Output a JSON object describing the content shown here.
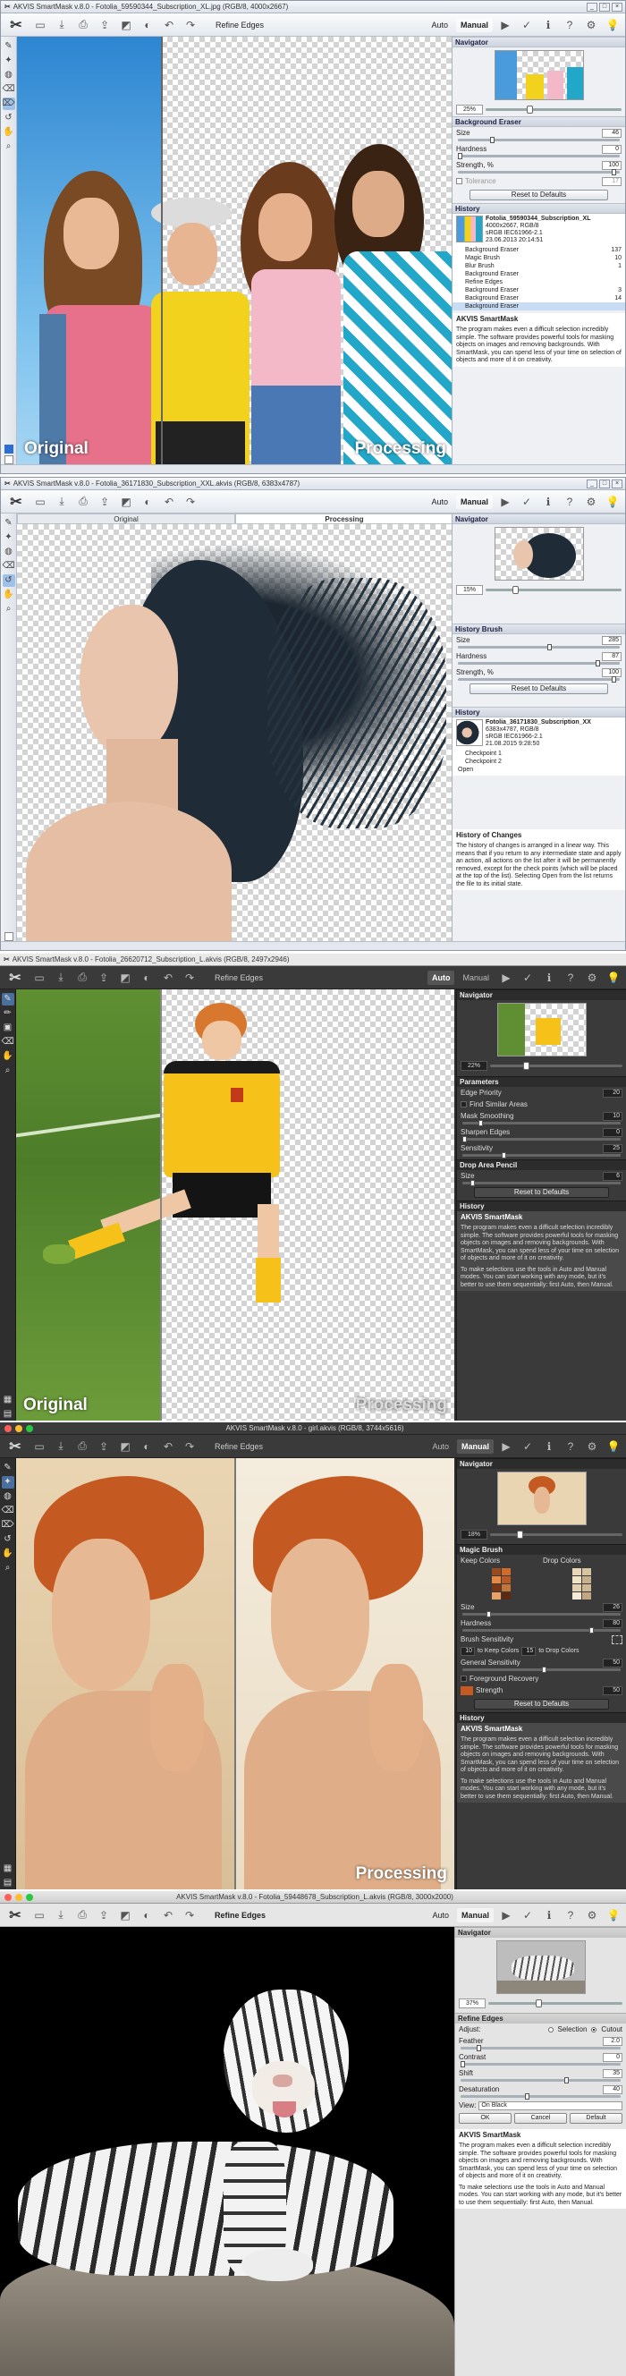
{
  "w1": {
    "title": "AKVIS SmartMask v.8.0 - Fotolia_59590344_Subscription_XL.jpg (RGB/8, 4000x2667)",
    "refine": "Refine Edges",
    "modes": {
      "auto": "Auto",
      "manual": "Manual"
    },
    "labels": {
      "original": "Original",
      "processing": "Processing"
    },
    "navigator": {
      "title": "Navigator",
      "zoom": "25%"
    },
    "bg_eraser": {
      "title": "Background Eraser",
      "params": [
        {
          "label": "Size",
          "value": "46"
        },
        {
          "label": "Hardness",
          "value": "0"
        },
        {
          "label": "Strength, %",
          "value": "100"
        }
      ],
      "tolerance_label": "Tolerance",
      "tolerance_value": "17",
      "reset": "Reset to Defaults"
    },
    "history": {
      "title": "History",
      "file_lines": [
        "Fotolia_59590344_Subscription_XL",
        "4000x2667, RGB/8",
        "sRGB IEC61966-2.1",
        "23.06.2013 20:14:51"
      ],
      "items": [
        {
          "label": "Background Eraser",
          "n": "137"
        },
        {
          "label": "Magic Brush",
          "n": "10"
        },
        {
          "label": "Blur Brush",
          "n": "1"
        },
        {
          "label": "Background Eraser",
          "n": ""
        },
        {
          "label": "Refine Edges",
          "n": ""
        },
        {
          "label": "Background Eraser",
          "n": "3"
        },
        {
          "label": "Background Eraser",
          "n": "14"
        },
        {
          "label": "Background Eraser",
          "n": ""
        }
      ]
    },
    "hint": {
      "title": "AKVIS SmartMask",
      "text": "The program makes even a difficult selection incredibly simple. The software provides powerful tools for masking objects on images and removing backgrounds. With SmartMask, you can spend less of your time on selection of objects and more of it on creativity."
    }
  },
  "w2": {
    "title": "AKVIS SmartMask v.8.0 - Fotolia_36171830_Subscription_XXL.akvis (RGB/8, 6383x4787)",
    "tabs": {
      "original": "Original",
      "processing": "Processing"
    },
    "modes": {
      "auto": "Auto",
      "manual": "Manual"
    },
    "navigator": {
      "title": "Navigator",
      "zoom": "15%"
    },
    "history_brush": {
      "title": "History Brush",
      "params": [
        {
          "label": "Size",
          "value": "285"
        },
        {
          "label": "Hardness",
          "value": "87"
        },
        {
          "label": "Strength, %",
          "value": "100"
        }
      ],
      "reset": "Reset to Defaults"
    },
    "history": {
      "title": "History",
      "file_lines": [
        "Fotolia_36171830_Subscription_XX",
        "6383x4787, RGB/8",
        "sRGB IEC61966-2.1",
        "21.08.2015 9:28:50"
      ],
      "items": [
        {
          "label": "Checkpoint 1",
          "n": ""
        },
        {
          "label": "Checkpoint 2",
          "n": ""
        },
        {
          "label": "Open",
          "n": ""
        }
      ]
    },
    "hint": {
      "title": "History of Changes",
      "text": "The history of changes is arranged in a linear way. This means that if you return to any intermediate state and apply an action, all actions on the list after it will be permanently removed, except for the check points (which will be placed at the top of the list). Selecting Open from the list returns the file to its initial state."
    }
  },
  "w3": {
    "title": "AKVIS SmartMask v.8.0 - Fotolia_26620712_Subscription_L.akvis (RGB/8, 2497x2946)",
    "refine": "Refine Edges",
    "modes": {
      "auto": "Auto",
      "manual": "Manual"
    },
    "labels": {
      "original": "Original",
      "processing": "Processing"
    },
    "navigator": {
      "title": "Navigator",
      "zoom": "22%"
    },
    "parameters": {
      "title": "Parameters",
      "rows": [
        {
          "label": "Edge Priority",
          "value": "20"
        },
        {
          "label": "Find Similar Areas",
          "value": ""
        },
        {
          "label": "Mask Smoothing",
          "value": "10"
        },
        {
          "label": "Sharpen Edges",
          "value": "0"
        },
        {
          "label": "Sensitivity",
          "value": "25"
        }
      ]
    },
    "drop_pencil": {
      "title": "Drop Area Pencil",
      "size_label": "Size",
      "size_value": "6"
    },
    "reset": "Reset to Defaults",
    "history_title": "History",
    "hint": {
      "title": "AKVIS SmartMask",
      "text": "The program makes even a difficult selection incredibly simple. The software provides powerful tools for masking objects on images and removing backgrounds. With SmartMask, you can spend less of your time on selection of objects and more of it on creativity.",
      "text2": "To make selections use the tools in Auto and Manual modes. You can start working with any mode, but it's better to use them sequentially: first Auto, then Manual."
    }
  },
  "w4": {
    "title": "AKVIS SmartMask v.8.0 - girl.akvis (RGB/8, 3744x5616)",
    "refine": "Refine Edges",
    "modes": {
      "auto": "Auto",
      "manual": "Manual"
    },
    "labels": {
      "processing": "Processing"
    },
    "navigator": {
      "title": "Navigator",
      "zoom": "18%"
    },
    "magic_brush": {
      "title": "Magic Brush",
      "keep_label": "Keep Colors",
      "drop_label": "Drop Colors",
      "keep_colors": [
        "#9a4b1e",
        "#d26a2a",
        "#e28a45",
        "#b85a26",
        "#7a3516",
        "#c47638",
        "#e7a36a",
        "#5c2a12"
      ],
      "drop_colors": [
        "#e9d8b8",
        "#d9c4a0",
        "#f1e3c8",
        "#c7b090",
        "#e4cfae",
        "#d0b894",
        "#f5ead6",
        "#bfa684"
      ],
      "params": [
        {
          "label": "Size",
          "value": "26"
        },
        {
          "label": "Hardness",
          "value": "80"
        }
      ],
      "brush_sensitivity": "Brush Sensitivity",
      "keep_val": "10",
      "to_keep": "to Keep Colors",
      "drop_val": "15",
      "to_drop": "to Drop Colors",
      "general_sensitivity": "General Sensitivity",
      "general_value": "50",
      "fg_recovery": "Foreground Recovery",
      "strength_label": "Strength",
      "strength_value": "50",
      "reset": "Reset to Defaults"
    },
    "history_title": "History",
    "hint": {
      "title": "AKVIS SmartMask",
      "text": "The program makes even a difficult selection incredibly simple. The software provides powerful tools for masking objects on images and removing backgrounds. With SmartMask, you can spend less of your time on selection of objects and more of it on creativity.",
      "text2": "To make selections use the tools in Auto and Manual modes. You can start working with any mode, but it's better to use them sequentially: first Auto, then Manual."
    }
  },
  "w5": {
    "title": "AKVIS SmartMask v.8.0 - Fotolia_59448678_Subscription_L.akvis (RGB/8, 3000x2000)",
    "refine": "Refine Edges",
    "modes": {
      "auto": "Auto",
      "manual": "Manual"
    },
    "navigator": {
      "title": "Navigator",
      "zoom": "37%"
    },
    "refine_panel": {
      "title": "Refine Edges",
      "adjust_label": "Adjust:",
      "selection_label": "Selection",
      "cutout_label": "Cutout",
      "rows": [
        {
          "label": "Feather",
          "value": "2.0"
        },
        {
          "label": "Contrast",
          "value": "0"
        },
        {
          "label": "Shift",
          "value": "35"
        },
        {
          "label": "Desaturation",
          "value": "40"
        }
      ],
      "view_label": "View:",
      "view_value": "On Black",
      "ok": "OK",
      "cancel": "Cancel",
      "default": "Default"
    },
    "hint": {
      "title": "AKVIS SmartMask",
      "text": "The program makes even a difficult selection incredibly simple. The software provides powerful tools for masking objects on images and removing backgrounds. With SmartMask, you can spend less of your time on selection of objects and more of it on creativity.",
      "text2": "To make selections use the tools in Auto and Manual modes. You can start working with any mode, but it's better to use them sequentially: first Auto, then Manual."
    }
  },
  "colors": {
    "accent": "#3d7fd1",
    "mac_red": "#ff5f56",
    "mac_yellow": "#ffbd2e",
    "mac_green": "#27c93f"
  }
}
